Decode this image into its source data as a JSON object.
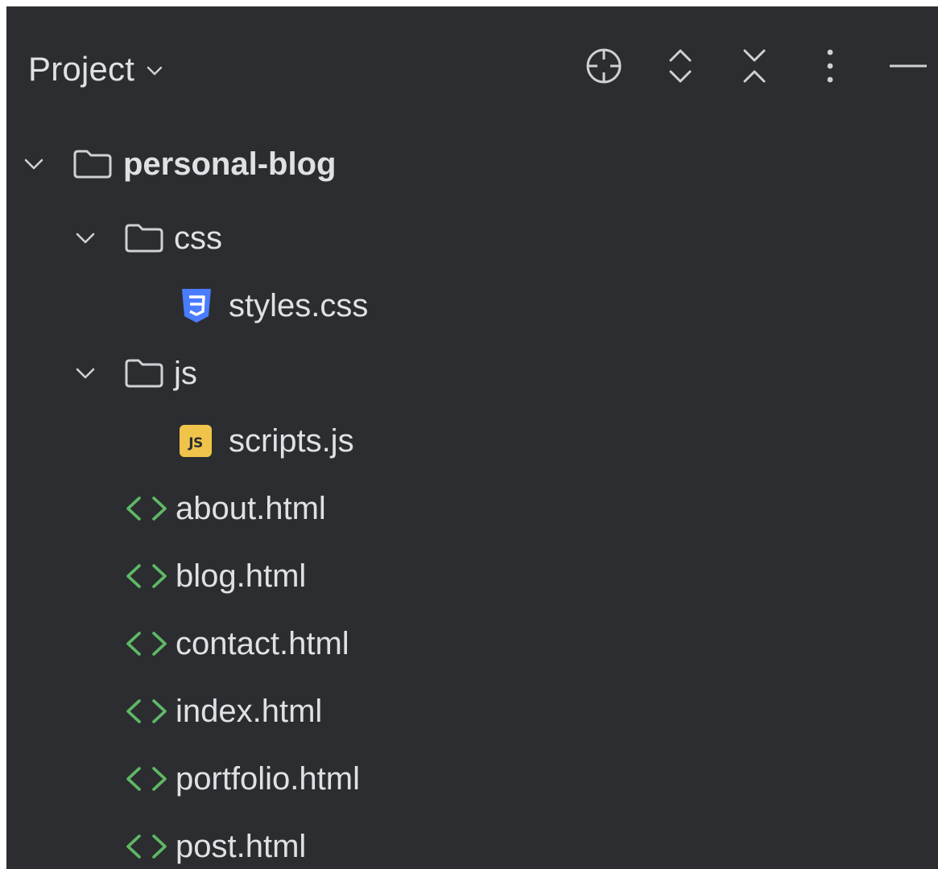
{
  "header": {
    "title": "Project",
    "icons": [
      "title-chevron-down-icon",
      "locate-crosshair-icon",
      "expand-all-icon",
      "collapse-all-icon",
      "more-options-icon",
      "minimize-icon"
    ]
  },
  "colors": {
    "background": "#2b2d30",
    "text": "#dfe1e5",
    "icon_gray": "#cfd1d5",
    "html_icon_green": "#5fb865",
    "css_icon_blue": "#4a7cff",
    "js_icon_yellow": "#f0c44a"
  },
  "tree": {
    "root": {
      "label": "personal-blog",
      "expanded": true,
      "icon": "folder-icon"
    },
    "css_folder": {
      "label": "css",
      "expanded": true,
      "icon": "folder-icon"
    },
    "styles_file": {
      "label": "styles.css",
      "icon": "css-file-icon"
    },
    "js_folder": {
      "label": "js",
      "expanded": true,
      "icon": "folder-icon"
    },
    "scripts_file": {
      "label": "scripts.js",
      "icon": "js-file-icon",
      "badge": "JS"
    },
    "html_files": [
      {
        "label": "about.html",
        "icon": "html-file-icon"
      },
      {
        "label": "blog.html",
        "icon": "html-file-icon"
      },
      {
        "label": "contact.html",
        "icon": "html-file-icon"
      },
      {
        "label": "index.html",
        "icon": "html-file-icon"
      },
      {
        "label": "portfolio.html",
        "icon": "html-file-icon"
      },
      {
        "label": "post.html",
        "icon": "html-file-icon"
      }
    ]
  }
}
